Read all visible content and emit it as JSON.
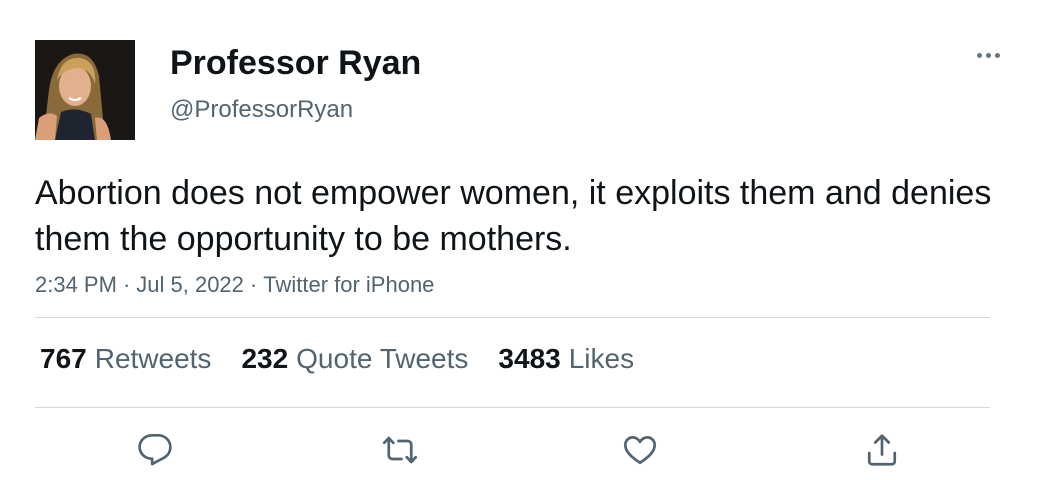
{
  "author": {
    "name": "Professor Ryan",
    "handle": "@ProfessorRyan",
    "avatar_icon": "profile-photo"
  },
  "tweet": {
    "text": "Abortion does not empower women, it exploits them and denies them the opportunity to be mothers.",
    "time": "2:34 PM",
    "date": "Jul 5, 2022",
    "source": "Twitter for iPhone",
    "separator": "·"
  },
  "stats": {
    "retweets": {
      "count": "767",
      "label": "Retweets"
    },
    "quote_tweets": {
      "count": "232",
      "label": "Quote Tweets"
    },
    "likes": {
      "count": "3483",
      "label": "Likes"
    }
  },
  "actions": [
    "reply-icon",
    "retweet-icon",
    "like-icon",
    "share-icon"
  ],
  "colors": {
    "text": "#0f1419",
    "secondary": "#536471",
    "divider": "#cfd9de"
  }
}
